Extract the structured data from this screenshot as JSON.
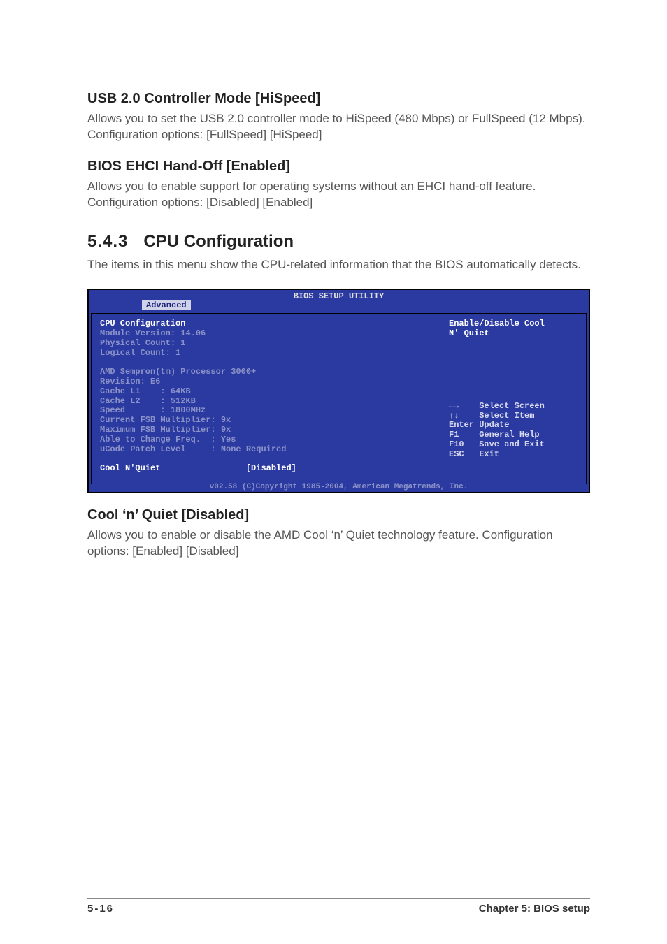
{
  "section1": {
    "heading": "USB 2.0 Controller Mode [HiSpeed]",
    "body": "Allows you to set the USB 2.0 controller mode to HiSpeed (480 Mbps) or FullSpeed (12 Mbps). Configuration options: [FullSpeed] [HiSpeed]"
  },
  "section2": {
    "heading": "BIOS EHCI Hand-Off [Enabled]",
    "body": "Allows you to enable support for operating systems without an EHCI hand-off feature. Configuration options: [Disabled] [Enabled]"
  },
  "section3": {
    "num": "5.4.3",
    "title": "CPU Configuration",
    "body": "The items in this menu show the CPU-related information that the BIOS automatically detects."
  },
  "bios": {
    "title": "BIOS SETUP UTILITY",
    "tab": "Advanced",
    "left": {
      "cpu_conf": "CPU Configuration",
      "module": "Module Version: 14.06",
      "phys": "Physical Count: 1",
      "logi": "Logical Count: 1",
      "proc": "AMD Sempron(tm) Processor 3000+",
      "rev": "Revision: E6",
      "l1": "Cache L1    : 64KB",
      "l2": "Cache L2    : 512KB",
      "spd": "Speed       : 1800MHz",
      "cfsb": "Current FSB Multiplier: 9x",
      "mfsb": "Maximum FSB Multiplier: 9x",
      "able": "Able to Change Freq.  : Yes",
      "ucode": "uCode Patch Level     : None Required",
      "cnq_label": "Cool N'Quiet",
      "cnq_value": "[Disabled]"
    },
    "right": {
      "help1": "Enable/Disable Cool",
      "help2": "N' Quiet",
      "k_lr": "←→    Select Screen",
      "k_ud": "↑↓    Select Item",
      "k_ent": "Enter Update",
      "k_f1": "F1    General Help",
      "k_f10": "F10   Save and Exit",
      "k_esc": "ESC   Exit"
    },
    "copyright": "v02.58 (C)Copyright 1985-2004, American Megatrends, Inc."
  },
  "section4": {
    "heading": "Cool ‘n’ Quiet [Disabled]",
    "body": "Allows you to enable or disable the AMD Cool ‘n’ Quiet technology feature. Configuration options: [Enabled] [Disabled]"
  },
  "footer": {
    "page": "5-16",
    "chapter": "Chapter 5: BIOS setup"
  }
}
